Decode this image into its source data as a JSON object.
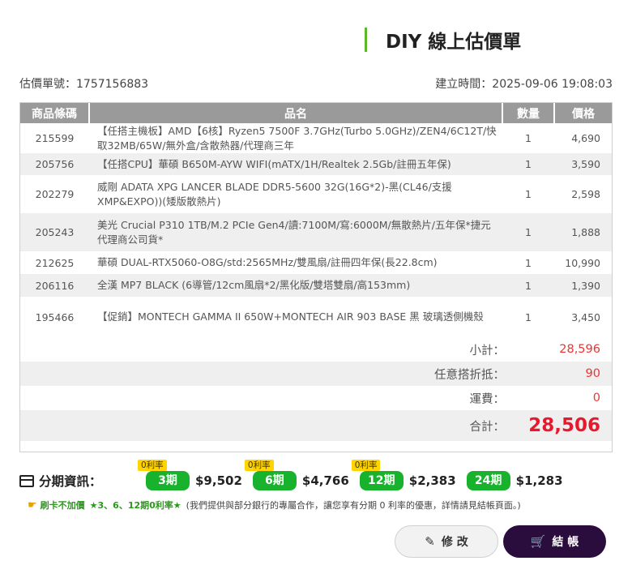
{
  "header": {
    "title": "DIY 線上估價單"
  },
  "meta": {
    "quote_no_label": "估價單號：",
    "quote_no": "1757156883",
    "created_label": "建立時間：",
    "created_at": "2025-09-06 19:08:03"
  },
  "table": {
    "headers": [
      "商品條碼",
      "品名",
      "數量",
      "價格"
    ],
    "rows": [
      {
        "code": "215599",
        "name": "【任搭主機板】AMD【6核】Ryzen5 7500F 3.7GHz(Turbo 5.0GHz)/ZEN4/6C12T/快取32MB/65W/無外盒/含散熱器/代理商三年",
        "qty": "1",
        "price": "4,690"
      },
      {
        "code": "205756",
        "name": "【任搭CPU】華碩 B650M-AYW WIFI(mATX/1H/Realtek 2.5Gb/註冊五年保)",
        "qty": "1",
        "price": "3,590"
      },
      {
        "code": "202279",
        "name": "威剛 ADATA XPG LANCER BLADE DDR5-5600 32G(16G*2)-黑(CL46/支援XMP&EXPO))(矮版散熱片)",
        "qty": "1",
        "price": "2,598"
      },
      {
        "code": "205243",
        "name": "美光 Crucial P310 1TB/M.2 PCIe Gen4/讀:7100M/寫:6000M/無散熱片/五年保*捷元代理商公司貨*",
        "qty": "1",
        "price": "1,888"
      },
      {
        "code": "212625",
        "name": "華碩 DUAL-RTX5060-O8G/std:2565MHz/雙風扇/註冊四年保(長22.8cm)",
        "qty": "1",
        "price": "10,990"
      },
      {
        "code": "206116",
        "name": "全漢 MP7 BLACK (6導管/12cm風扇*2/黑化版/雙塔雙扇/高153mm)",
        "qty": "1",
        "price": "1,390"
      },
      {
        "code": "195466",
        "name": "【促銷】MONTECH GAMMA II 650W+MONTECH AIR 903 BASE 黑 玻璃透側機殼",
        "qty": "1",
        "price": "3,450"
      }
    ]
  },
  "summary": {
    "subtotal_label": "小計：",
    "subtotal": "28,596",
    "discount_label": "任意搭折抵：",
    "discount": "90",
    "shipping_label": "運費：",
    "shipping": "0",
    "total_label": "合計：",
    "total": "28,506"
  },
  "installments": {
    "title": "分期資訊：",
    "plans": [
      {
        "tag": "0利率",
        "label": "3期",
        "amount": "$9,502"
      },
      {
        "tag": "0利率",
        "label": "6期",
        "amount": "$4,766"
      },
      {
        "tag": "0利率",
        "label": "12期",
        "amount": "$2,383"
      },
      {
        "tag": "",
        "label": "24期",
        "amount": "$1,283"
      }
    ]
  },
  "promo": {
    "highlight": "刷卡不加價",
    "rates": "★3、6、12期0利率★",
    "note": "(我們提供與部分銀行的專屬合作，讓您享有分期 0 利率的優惠，詳情請見結帳頁面。)"
  },
  "actions": {
    "edit": "修 改",
    "checkout": "結 帳"
  },
  "colors": {
    "accent_green": "#19b22c",
    "title_bar": "#5cb82a",
    "total_red": "#e8192c",
    "checkout_bg": "#2a0d3c"
  }
}
